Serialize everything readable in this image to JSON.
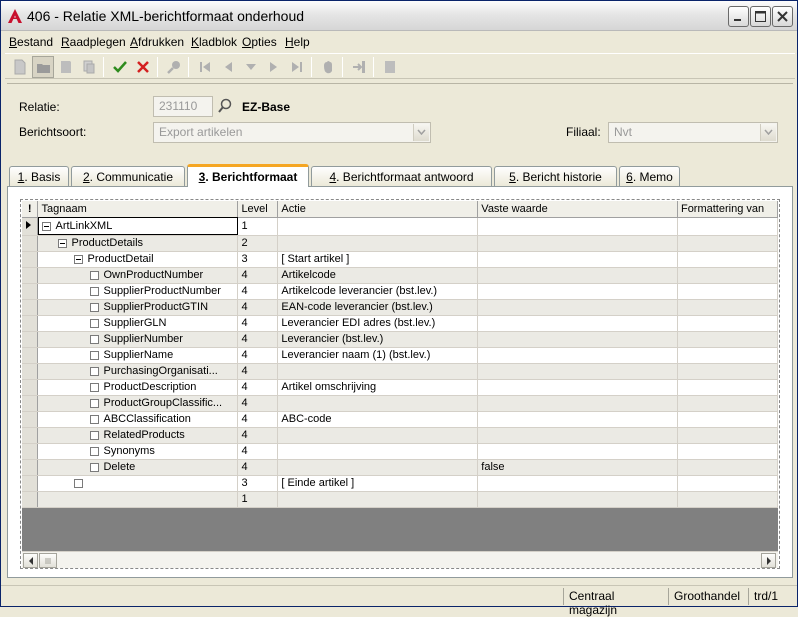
{
  "window": {
    "title": "406 - Relatie XML-berichtformaat onderhoud"
  },
  "menu": [
    {
      "u": "B",
      "rest": "estand"
    },
    {
      "u": "R",
      "rest": "aadplegen"
    },
    {
      "u": "A",
      "rest": "fdrukken"
    },
    {
      "u": "K",
      "rest": "ladblok"
    },
    {
      "u": "O",
      "rest": "pties"
    },
    {
      "u": "H",
      "rest": "elp"
    }
  ],
  "header": {
    "relatie_label": "Relatie:",
    "relatie_value": "231110",
    "relatie_name": "EZ-Base",
    "berichtsoort_label": "Berichtsoort:",
    "berichtsoort_value": "Export artikelen",
    "filiaal_label": "Filiaal:",
    "filiaal_value": "Nvt"
  },
  "tabs": [
    {
      "u": "1",
      "rest": ". Basis"
    },
    {
      "u": "2",
      "rest": ". Communicatie"
    },
    {
      "u": "3",
      "rest": ". Berichtformaat"
    },
    {
      "u": "4",
      "rest": ". Berichtformaat antwoord"
    },
    {
      "u": "5",
      "rest": ". Bericht historie"
    },
    {
      "u": "6",
      "rest": ". Memo"
    }
  ],
  "grid": {
    "columns": {
      "indicator": "!",
      "tagnaam": "Tagnaam",
      "level": "Level",
      "actie": "Actie",
      "vaste_waarde": "Vaste waarde",
      "formattering": "Formattering van"
    },
    "rows": [
      {
        "tag": "ArtLinkXML",
        "level": "1",
        "actie": "",
        "vaste": ""
      },
      {
        "tag": "ProductDetails",
        "level": "2",
        "actie": "",
        "vaste": ""
      },
      {
        "tag": "ProductDetail",
        "level": "3",
        "actie": "[ Start artikel ]",
        "vaste": ""
      },
      {
        "tag": "OwnProductNumber",
        "level": "4",
        "actie": "Artikelcode",
        "vaste": ""
      },
      {
        "tag": "SupplierProductNumber",
        "level": "4",
        "actie": "Artikelcode leverancier (bst.lev.)",
        "vaste": ""
      },
      {
        "tag": "SupplierProductGTIN",
        "level": "4",
        "actie": "EAN-code leverancier (bst.lev.)",
        "vaste": ""
      },
      {
        "tag": "SupplierGLN",
        "level": "4",
        "actie": "Leverancier EDI adres (bst.lev.)",
        "vaste": ""
      },
      {
        "tag": "SupplierNumber",
        "level": "4",
        "actie": "Leverancier (bst.lev.)",
        "vaste": ""
      },
      {
        "tag": "SupplierName",
        "level": "4",
        "actie": "Leverancier naam (1) (bst.lev.)",
        "vaste": ""
      },
      {
        "tag": "PurchasingOrganisati...",
        "level": "4",
        "actie": "",
        "vaste": ""
      },
      {
        "tag": "ProductDescription",
        "level": "4",
        "actie": "Artikel omschrijving",
        "vaste": ""
      },
      {
        "tag": "ProductGroupClassific...",
        "level": "4",
        "actie": "",
        "vaste": ""
      },
      {
        "tag": "ABCClassification",
        "level": "4",
        "actie": "ABC-code",
        "vaste": ""
      },
      {
        "tag": "RelatedProducts",
        "level": "4",
        "actie": "",
        "vaste": ""
      },
      {
        "tag": "Synonyms",
        "level": "4",
        "actie": "",
        "vaste": ""
      },
      {
        "tag": "Delete",
        "level": "4",
        "actie": "",
        "vaste": "false"
      },
      {
        "tag": "",
        "level": "3",
        "actie": "[ Einde artikel ]",
        "vaste": ""
      },
      {
        "tag": "",
        "level": "1",
        "actie": "",
        "vaste": ""
      }
    ]
  },
  "status": {
    "magazijn": "Centraal magazijn",
    "type": "Groothandel",
    "user": "trd/1"
  }
}
